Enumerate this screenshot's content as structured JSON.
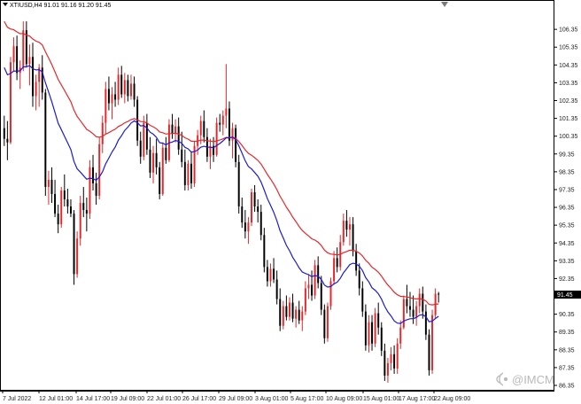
{
  "header": {
    "symbol_line": "XTIUSD,H4  91.01 91.16 91.20 91.45"
  },
  "current_price_label": "91.45",
  "watermark": "@IMCM",
  "colors": {
    "bull": "#e8262a",
    "bear": "#000000",
    "ma_fast": "#1b1bd6",
    "ma_slow": "#e8262a",
    "price_tag": "#000000",
    "axis": "#000000"
  },
  "icons": {
    "menu_indicator": "triangle-down-icon",
    "watermark_logo": "signal-icon"
  },
  "chart_data": {
    "type": "candlestick",
    "title": "XTIUSD,H4",
    "ylim": [
      86.3,
      107.8
    ],
    "y_ticks": [
      "106.35",
      "105.35",
      "104.35",
      "103.35",
      "102.35",
      "101.35",
      "100.35",
      "99.35",
      "98.35",
      "97.35",
      "96.35",
      "95.35",
      "94.35",
      "93.35",
      "92.35",
      "91.35",
      "90.35",
      "89.35",
      "88.35",
      "87.35",
      "86.35"
    ],
    "x_ticks": [
      "7 Jul 2022",
      "12 Jul 01:00",
      "14 Jul 17:00",
      "19 Jul 09:00",
      "22 Jul 01:00",
      "26 Jul 17:00",
      "29 Jul 09:00",
      "3 Aug 01:00",
      "5 Aug 17:00",
      "10 Aug 09:00",
      "15 Aug 01:00",
      "17 Aug 17:00",
      "22 Aug 09:00"
    ],
    "series": [
      {
        "type": "candlestick",
        "values": [
          [
            100.8,
            101.5,
            99.8,
            100.2
          ],
          [
            100.2,
            101.2,
            99.0,
            100.0
          ],
          [
            100.0,
            104.8,
            99.9,
            104.5
          ],
          [
            104.5,
            105.9,
            104.0,
            105.4
          ],
          [
            105.4,
            106.0,
            103.5,
            103.9
          ],
          [
            103.9,
            104.6,
            103.0,
            104.2
          ],
          [
            104.2,
            106.8,
            104.0,
            106.3
          ],
          [
            106.3,
            106.8,
            104.2,
            104.4
          ],
          [
            104.4,
            105.5,
            103.2,
            104.8
          ],
          [
            104.8,
            105.6,
            102.0,
            102.6
          ],
          [
            102.6,
            103.8,
            101.8,
            103.4
          ],
          [
            103.4,
            104.4,
            102.0,
            104.2
          ],
          [
            104.2,
            104.9,
            102.4,
            102.8
          ],
          [
            102.8,
            103.0,
            97.0,
            97.5
          ],
          [
            97.5,
            98.4,
            96.5,
            97.9
          ],
          [
            97.9,
            98.6,
            96.6,
            97.1
          ],
          [
            97.1,
            97.9,
            95.8,
            96.0
          ],
          [
            96.0,
            96.5,
            94.9,
            95.4
          ],
          [
            95.4,
            97.5,
            95.2,
            97.3
          ],
          [
            97.3,
            98.2,
            96.4,
            96.8
          ],
          [
            96.8,
            97.4,
            96.0,
            96.4
          ],
          [
            96.4,
            96.8,
            95.8,
            96.0
          ],
          [
            96.0,
            96.2,
            92.0,
            92.6
          ],
          [
            92.6,
            95.0,
            92.4,
            94.6
          ],
          [
            94.6,
            97.0,
            94.2,
            96.6
          ],
          [
            96.6,
            97.5,
            95.8,
            96.2
          ],
          [
            96.2,
            96.9,
            95.0,
            96.0
          ],
          [
            96.0,
            99.0,
            95.7,
            98.6
          ],
          [
            98.6,
            99.3,
            97.3,
            97.7
          ],
          [
            97.7,
            98.3,
            96.5,
            97.0
          ],
          [
            97.0,
            100.3,
            96.8,
            99.9
          ],
          [
            99.9,
            101.5,
            99.4,
            101.1
          ],
          [
            101.1,
            103.4,
            100.5,
            103.0
          ],
          [
            103.0,
            103.7,
            101.8,
            102.2
          ],
          [
            102.2,
            103.1,
            101.3,
            102.7
          ],
          [
            102.7,
            103.4,
            102.0,
            102.4
          ],
          [
            102.4,
            104.2,
            102.1,
            103.8
          ],
          [
            103.8,
            104.3,
            102.5,
            102.7
          ],
          [
            102.7,
            103.9,
            102.2,
            103.5
          ],
          [
            103.5,
            103.8,
            102.3,
            102.6
          ],
          [
            102.6,
            103.8,
            102.4,
            103.3
          ],
          [
            103.3,
            103.7,
            102.0,
            102.4
          ],
          [
            102.4,
            102.6,
            99.8,
            100.1
          ],
          [
            100.1,
            100.6,
            98.8,
            99.2
          ],
          [
            99.2,
            101.5,
            99.0,
            101.1
          ],
          [
            101.1,
            101.6,
            99.3,
            99.6
          ],
          [
            99.6,
            100.3,
            98.0,
            98.3
          ],
          [
            98.3,
            99.8,
            97.7,
            99.4
          ],
          [
            99.4,
            100.2,
            98.2,
            98.6
          ],
          [
            98.6,
            98.9,
            96.8,
            97.1
          ],
          [
            97.1,
            100.0,
            97.0,
            99.7
          ],
          [
            99.7,
            100.3,
            98.8,
            99.0
          ],
          [
            99.0,
            101.3,
            98.9,
            101.0
          ],
          [
            101.0,
            101.6,
            100.2,
            100.5
          ],
          [
            100.5,
            101.3,
            100.0,
            100.9
          ],
          [
            100.9,
            101.4,
            99.3,
            99.6
          ],
          [
            99.6,
            100.6,
            98.6,
            98.9
          ],
          [
            98.9,
            99.6,
            97.3,
            97.6
          ],
          [
            97.6,
            99.0,
            97.3,
            98.8
          ],
          [
            98.8,
            99.5,
            97.4,
            97.7
          ],
          [
            97.7,
            100.1,
            97.5,
            99.8
          ],
          [
            99.8,
            100.7,
            99.3,
            100.4
          ],
          [
            100.4,
            101.5,
            99.9,
            101.2
          ],
          [
            101.2,
            101.8,
            100.0,
            100.3
          ],
          [
            100.3,
            100.8,
            98.9,
            99.2
          ],
          [
            99.2,
            100.2,
            98.5,
            99.8
          ],
          [
            99.8,
            100.3,
            98.9,
            99.3
          ],
          [
            99.3,
            101.4,
            99.2,
            101.1
          ],
          [
            101.1,
            101.6,
            100.6,
            101.0
          ],
          [
            101.0,
            101.8,
            100.4,
            101.5
          ],
          [
            101.5,
            104.4,
            100.8,
            101.9
          ],
          [
            101.9,
            102.3,
            99.8,
            100.1
          ],
          [
            100.1,
            101.1,
            99.1,
            100.8
          ],
          [
            100.8,
            101.0,
            98.6,
            98.9
          ],
          [
            98.9,
            99.3,
            96.0,
            96.4
          ],
          [
            96.4,
            96.9,
            95.2,
            95.5
          ],
          [
            95.5,
            96.2,
            94.6,
            95.0
          ],
          [
            95.0,
            95.8,
            94.3,
            95.5
          ],
          [
            95.5,
            97.4,
            95.3,
            97.2
          ],
          [
            97.2,
            97.6,
            96.1,
            96.4
          ],
          [
            96.4,
            96.8,
            95.5,
            96.1
          ],
          [
            96.1,
            96.5,
            94.5,
            94.8
          ],
          [
            94.8,
            95.2,
            92.7,
            93.0
          ],
          [
            93.0,
            93.4,
            91.9,
            92.2
          ],
          [
            92.2,
            93.2,
            91.9,
            92.9
          ],
          [
            92.9,
            93.5,
            92.1,
            92.3
          ],
          [
            92.3,
            92.8,
            90.9,
            91.2
          ],
          [
            91.2,
            91.8,
            89.4,
            89.7
          ],
          [
            89.7,
            91.1,
            89.5,
            90.8
          ],
          [
            90.8,
            91.4,
            90.0,
            90.2
          ],
          [
            90.2,
            91.3,
            90.0,
            91.0
          ],
          [
            91.0,
            91.5,
            89.9,
            90.1
          ],
          [
            90.1,
            90.8,
            89.6,
            90.6
          ],
          [
            90.6,
            91.1,
            89.8,
            90.0
          ],
          [
            90.0,
            90.8,
            89.4,
            90.5
          ],
          [
            90.5,
            92.2,
            90.3,
            91.8
          ],
          [
            91.8,
            92.6,
            91.2,
            92.0
          ],
          [
            92.0,
            92.8,
            91.1,
            91.4
          ],
          [
            91.4,
            93.4,
            91.2,
            93.1
          ],
          [
            93.1,
            93.6,
            91.8,
            92.1
          ],
          [
            92.1,
            92.5,
            90.3,
            90.6
          ],
          [
            90.6,
            90.9,
            88.7,
            89.0
          ],
          [
            89.0,
            91.0,
            88.8,
            90.8
          ],
          [
            90.8,
            92.4,
            90.6,
            92.2
          ],
          [
            92.2,
            93.9,
            92.0,
            93.5
          ],
          [
            93.5,
            94.1,
            92.7,
            93.0
          ],
          [
            93.0,
            94.8,
            92.8,
            94.4
          ],
          [
            94.4,
            96.0,
            94.2,
            95.6
          ],
          [
            95.6,
            96.2,
            94.7,
            95.1
          ],
          [
            95.1,
            95.8,
            94.2,
            95.4
          ],
          [
            95.4,
            95.8,
            93.6,
            93.9
          ],
          [
            93.9,
            94.3,
            92.5,
            92.8
          ],
          [
            92.8,
            93.2,
            91.4,
            91.8
          ],
          [
            91.8,
            92.2,
            90.2,
            90.5
          ],
          [
            90.5,
            90.9,
            88.3,
            88.6
          ],
          [
            88.6,
            90.3,
            88.2,
            89.9
          ],
          [
            89.9,
            90.3,
            88.3,
            88.7
          ],
          [
            88.7,
            90.7,
            88.5,
            90.4
          ],
          [
            90.4,
            91.0,
            89.2,
            89.6
          ],
          [
            89.6,
            89.9,
            88.0,
            88.3
          ],
          [
            88.3,
            88.7,
            86.6,
            86.9
          ],
          [
            86.9,
            87.9,
            86.5,
            87.6
          ],
          [
            87.6,
            88.5,
            87.2,
            88.1
          ],
          [
            88.1,
            88.6,
            87.0,
            87.3
          ],
          [
            87.3,
            89.0,
            87.0,
            88.7
          ],
          [
            88.7,
            90.0,
            88.4,
            89.6
          ],
          [
            89.6,
            91.4,
            89.5,
            91.2
          ],
          [
            91.2,
            92.0,
            90.4,
            90.8
          ],
          [
            90.8,
            91.6,
            90.2,
            90.6
          ],
          [
            90.6,
            91.4,
            89.8,
            90.2
          ],
          [
            90.2,
            91.1,
            89.7,
            90.8
          ],
          [
            90.8,
            91.8,
            90.4,
            91.5
          ],
          [
            91.5,
            91.9,
            90.1,
            90.5
          ],
          [
            90.5,
            90.9,
            88.9,
            89.2
          ],
          [
            89.2,
            89.5,
            86.9,
            87.2
          ],
          [
            87.2,
            90.6,
            87.0,
            90.3
          ],
          [
            90.3,
            91.8,
            90.1,
            91.5
          ],
          [
            91.5,
            91.6,
            91.0,
            91.45
          ]
        ]
      },
      {
        "name": "",
        "type": "line",
        "role": "ma_slow"
      },
      {
        "name": "",
        "type": "line",
        "role": "ma_fast"
      }
    ],
    "grid": false,
    "legend": "none"
  }
}
